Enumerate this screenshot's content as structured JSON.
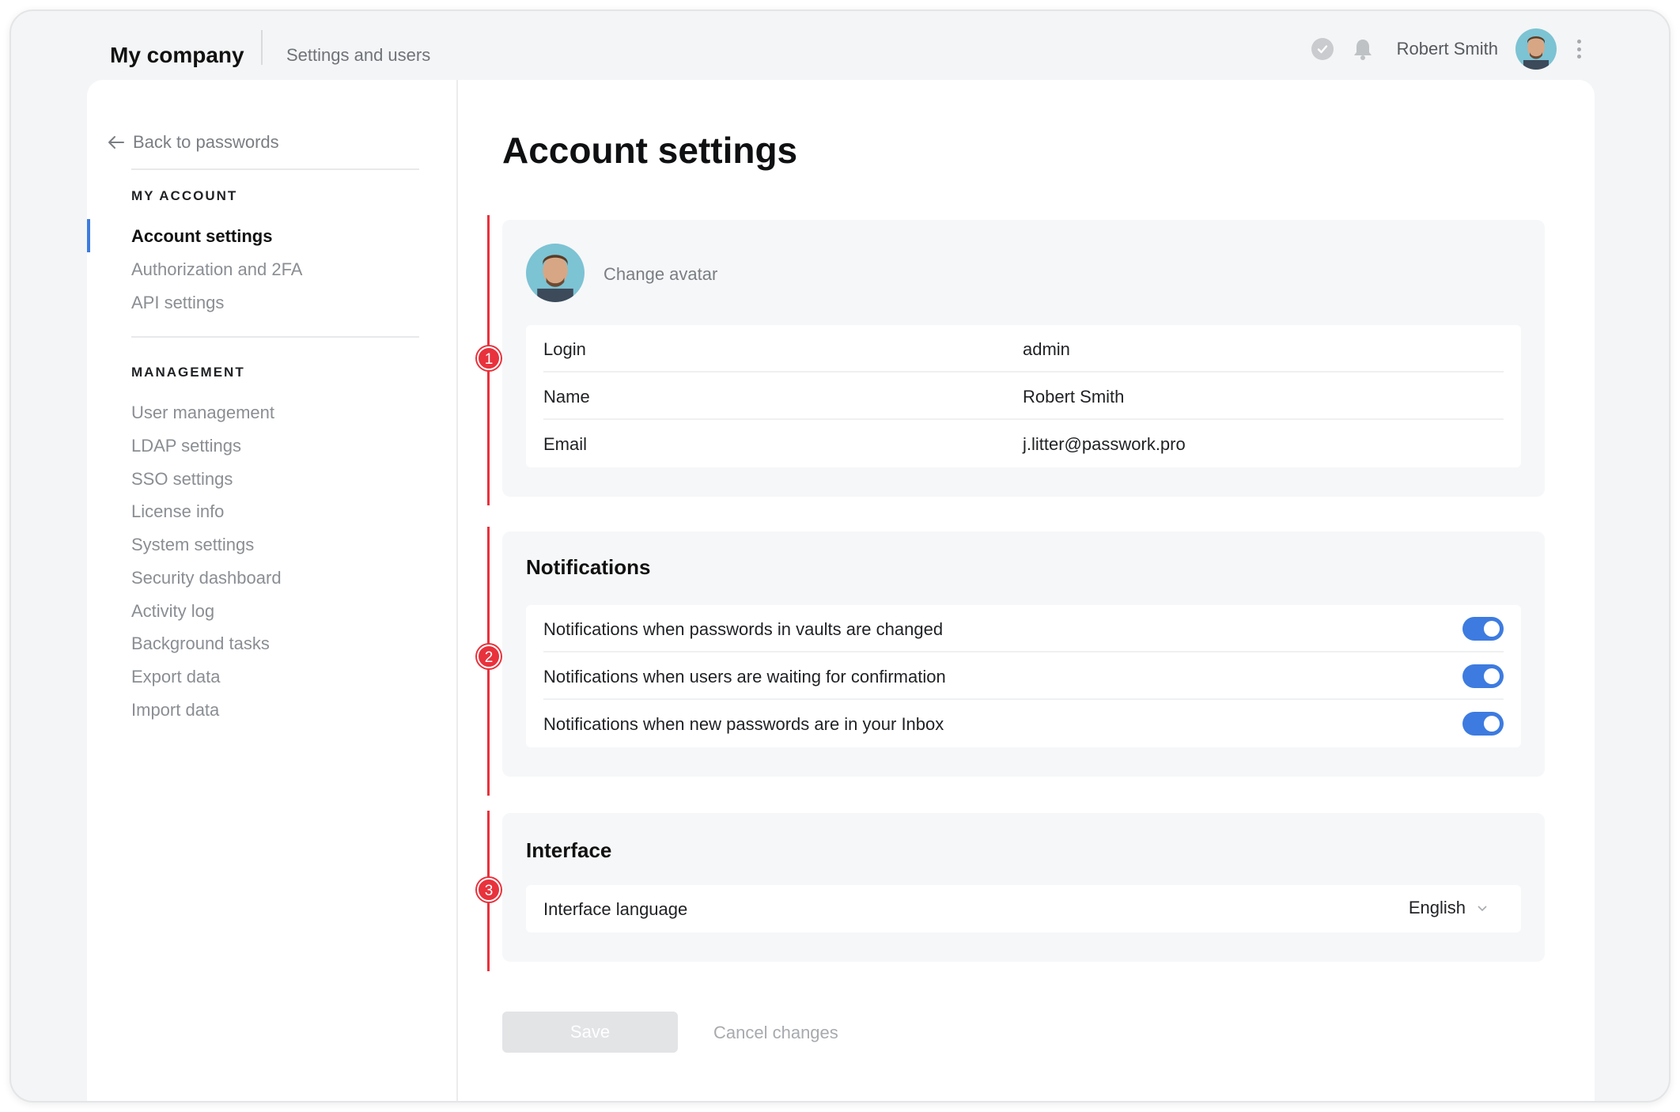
{
  "topbar": {
    "brand": "My company",
    "section": "Settings and users",
    "user_name": "Robert Smith"
  },
  "sidebar": {
    "back_link": "Back to passwords",
    "my_account_heading": "MY ACCOUNT",
    "my_account_items": [
      "Account settings",
      "Authorization and 2FA",
      "API settings"
    ],
    "management_heading": "MANAGEMENT",
    "management_items": [
      "User management",
      "LDAP settings",
      "SSO settings",
      "License info",
      "System settings",
      "Security dashboard",
      "Activity log",
      "Background tasks",
      "Export data",
      "Import data"
    ]
  },
  "main": {
    "title": "Account settings",
    "markers": [
      "1",
      "2",
      "3"
    ],
    "profile": {
      "change_avatar": "Change avatar",
      "rows": [
        {
          "key": "Login",
          "value": "admin"
        },
        {
          "key": "Name",
          "value": "Robert Smith"
        },
        {
          "key": "Email",
          "value": "j.litter@passwork.pro"
        }
      ]
    },
    "notifications": {
      "title": "Notifications",
      "rows": [
        {
          "label": "Notifications when passwords in vaults are changed",
          "enabled": true
        },
        {
          "label": "Notifications when users are waiting for confirmation",
          "enabled": true
        },
        {
          "label": "Notifications when new passwords are in your Inbox",
          "enabled": true
        }
      ]
    },
    "interface": {
      "title": "Interface",
      "language_label": "Interface language",
      "language_value": "English"
    },
    "actions": {
      "save": "Save",
      "cancel": "Cancel changes"
    }
  },
  "colors": {
    "accent": "#3d7be0",
    "marker_red": "#e8323c"
  }
}
